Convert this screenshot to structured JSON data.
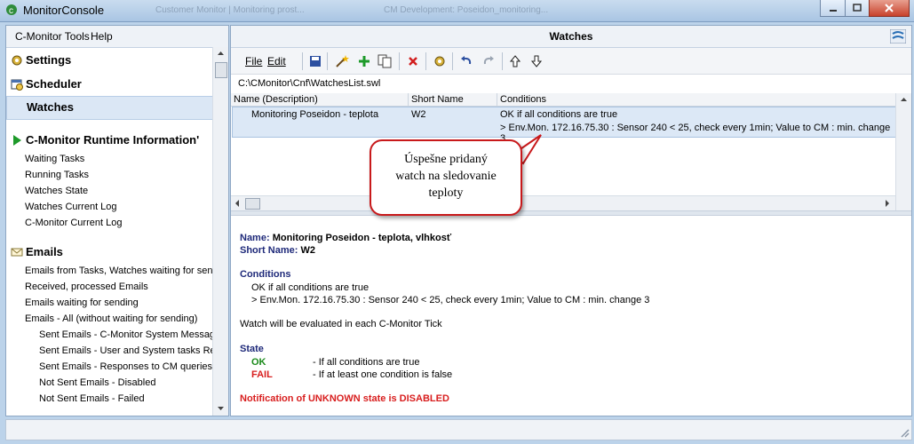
{
  "app": {
    "title": "MonitorConsole",
    "bg_tab1": "Customer Monitor | Monitoring prost...",
    "bg_tab2": "CM Development: Poseidon_monitoring..."
  },
  "menu": {
    "tools": "C-Monitor Tools",
    "help": "Help"
  },
  "sidebar": {
    "settings": "Settings",
    "scheduler": "Scheduler",
    "watches": "Watches",
    "runtime": "C-Monitor Runtime Information'",
    "runtime_items": [
      "Waiting Tasks",
      "Running Tasks",
      "Watches State",
      "Watches Current Log",
      "C-Monitor Current Log"
    ],
    "emails": "Emails",
    "email_items": [
      "Emails from Tasks, Watches waiting for send",
      "Received, processed Emails",
      "Emails waiting for sending",
      "Emails - All (without waiting for sending)"
    ],
    "email_subitems": [
      "Sent Emails - C-Monitor System Message",
      "Sent Emails - User and System tasks Res",
      "Sent Emails - Responses to CM queries",
      "Not Sent Emails - Disabled",
      "Not Sent Emails - Failed"
    ]
  },
  "panel": {
    "title": "Watches",
    "file": "File",
    "edit": "Edit"
  },
  "path": "C:\\CMonitor\\Cnf\\WatchesList.swl",
  "table": {
    "headers": [
      "Name (Description)",
      "Short Name",
      "Conditions"
    ],
    "row": {
      "name": "Monitoring Poseidon - teplota",
      "short": "W2",
      "cond1": "OK if all conditions are true",
      "cond2": "> Env.Mon. 172.16.75.30 : Sensor 240 < 25, check every 1min; Value to CM : min. change 3"
    }
  },
  "callout": {
    "line1": "Úspešne pridaný",
    "line2": "watch na sledovanie",
    "line3": "teploty"
  },
  "detail": {
    "name_label": "Name:",
    "name_value": "Monitoring Poseidon - teplota, vlhkosť",
    "short_label": "Short Name:",
    "short_value": "W2",
    "conditions_label": "Conditions",
    "cond1": "OK if all conditions are true",
    "cond2": "> Env.Mon. 172.16.75.30 : Sensor 240 < 25, check every 1min; Value to CM : min. change 3",
    "evaluated": "Watch will be evaluated in each C-Monitor Tick",
    "state_label": "State",
    "ok": "OK",
    "ok_desc": "- If all conditions are true",
    "fail": "FAIL",
    "fail_desc": "- If at least one condition is false",
    "notification": "Notification of UNKNOWN state is DISABLED"
  },
  "colors": {
    "ok": "#1a8a1a",
    "fail": "#d81e1e",
    "navy": "#1f2a7a",
    "selection": "#dce8f6"
  }
}
